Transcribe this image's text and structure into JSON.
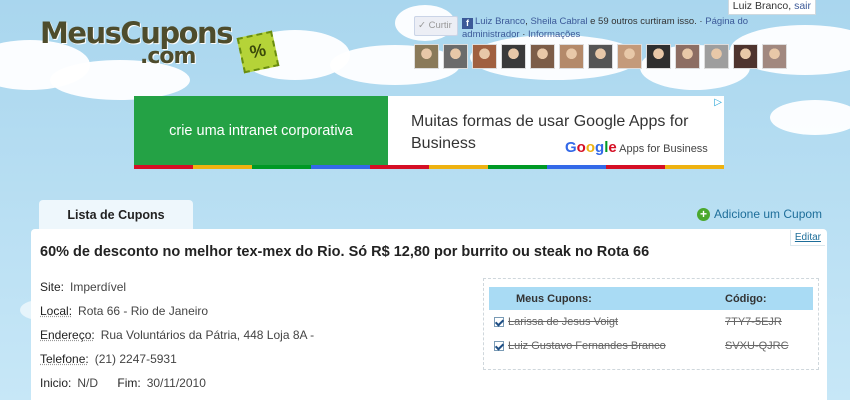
{
  "user": {
    "name": "Luiz Branco,",
    "logout": "sair"
  },
  "logo": {
    "word": "MeusCupons",
    "dotcom": ".com",
    "tag_symbol": "%"
  },
  "facebook": {
    "like_button": "Curtir",
    "icon": "f",
    "friend1": "Luiz Branco",
    "sep": ", ",
    "friend2": "Sheila Cabral",
    "others": " e 59 outros curtiram isso. · ",
    "admin_link": "Página do administrador",
    "dot": " · ",
    "info_link": "Informações",
    "faces_count": 13
  },
  "ad": {
    "left_text": "crie uma intranet corporativa",
    "title": "Muitas formas de usar Google Apps for Business",
    "google_letters": [
      "G",
      "o",
      "o",
      "g",
      "l",
      "e"
    ],
    "google_suffix": " Apps for Business",
    "choice_icon": "▷",
    "stripe_colors": [
      "#d50f25",
      "#eeb211",
      "#009925",
      "#3369e8",
      "#d50f25",
      "#eeb211",
      "#009925",
      "#3369e8",
      "#d50f25",
      "#eeb211"
    ]
  },
  "tabs": {
    "list": "Lista de Cupons"
  },
  "actions": {
    "add_coupon": "Adicione um Cupom",
    "edit": "Editar"
  },
  "coupon": {
    "title": "60% de desconto no melhor tex-mex do Rio. Só R$ 12,80 por burrito ou steak no Rota 66",
    "site_label": "Site:",
    "site": "Imperdível",
    "local_label": "Local:",
    "local": "Rota 66 - Rio de Janeiro",
    "address_label": "Endereço:",
    "address": "Rua Voluntários da Pátria, 448 Loja 8A -",
    "phone_label": "Telefone:",
    "phone": "(21) 2247-5931",
    "start_label": "Inicio:",
    "start": "N/D",
    "end_label": "Fim:",
    "end": "30/11/2010"
  },
  "my_coupons": {
    "header_name": "Meus Cupons:",
    "header_code": "Código:",
    "rows": [
      {
        "name": "Larissa de Jesus Voigt",
        "code": "7TY7-5EJR",
        "checked": true
      },
      {
        "name": "Luiz Gustavo Fernandes Branco",
        "code": "SVXU-QJRC",
        "checked": true
      }
    ]
  },
  "colors": {
    "green": "#7aa31a",
    "sky": "#b7def2",
    "link": "#1e6e9a"
  }
}
